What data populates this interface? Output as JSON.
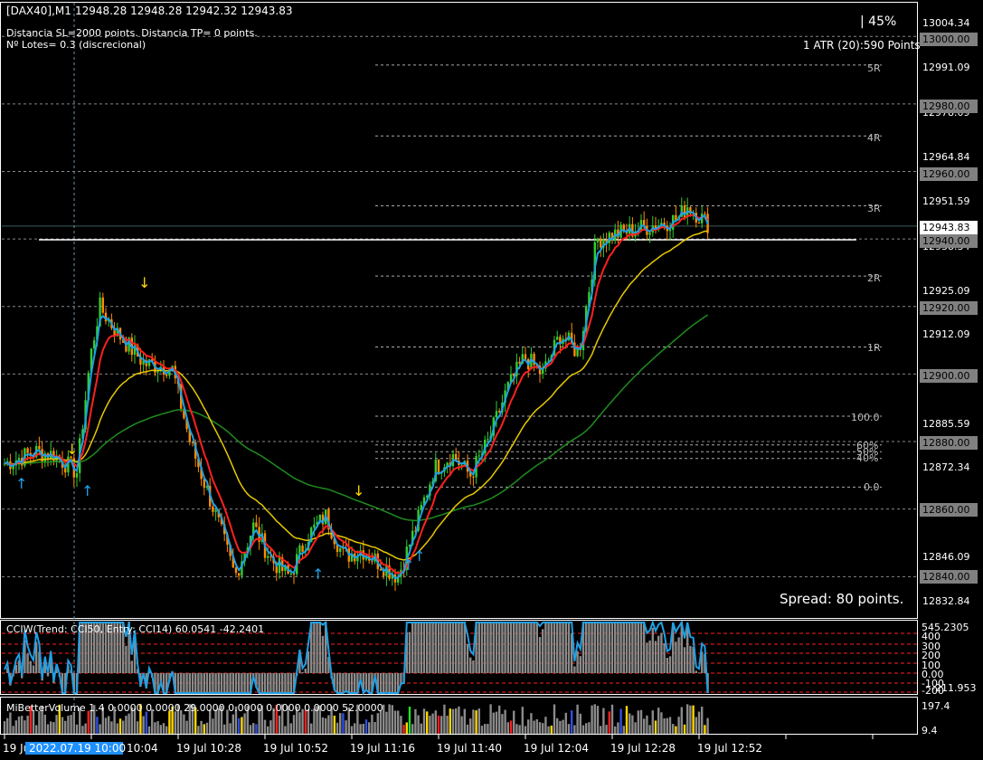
{
  "header": {
    "symbol": "[DAX40],M1",
    "ohlc": "12948.28 12948.28 12942.32 12943.83",
    "sl_tp_info": "Distancia SL=2000 points. Distancia TP= 0 points.",
    "lots_info": "Nº Lotes= 0.3 (discrecional)",
    "percent": "|  45%",
    "atr": "1 ATR (20):590 Points"
  },
  "spread": "Spread: 80 points.",
  "price_axis": {
    "labels": [
      "13004.34",
      "12991.09",
      "12978.09",
      "12964.84",
      "12951.59",
      "12938.34",
      "12925.09",
      "12912.09",
      "12898.84",
      "12885.59",
      "12872.34",
      "12846.09",
      "12832.84"
    ],
    "round_levels": [
      "13000.00",
      "12980.00",
      "12960.00",
      "12940.00",
      "12920.00",
      "12900.00",
      "12880.00",
      "12860.00",
      "12840.00"
    ],
    "current_price": "12943.83"
  },
  "levels": {
    "r_labels": [
      "5R",
      "4R",
      "3R",
      "2R",
      "1R"
    ],
    "fib_labels": [
      "100.0",
      "60%",
      "50%",
      "40%",
      "0.0"
    ]
  },
  "cci": {
    "title": "CCIW(Trend: CCI50, Entry: CCI14) 60.0541 -42.2401",
    "scale": [
      "545.2305",
      "400",
      "300",
      "200",
      "100",
      "0.00",
      "-100",
      "-200",
      "-211.953"
    ]
  },
  "volume": {
    "title": "MiBetterVolume 1.4 0.0000 0.0000 29.0000 0.0000 0.0000 0.0000 52.0000",
    "scale": [
      "197.4",
      "9.4"
    ]
  },
  "time_axis": {
    "cursor_label": "2022.07.19 10:00",
    "labels": [
      "19 Jul",
      "10:04",
      "19 Jul 10:28",
      "19 Jul 10:52",
      "19 Jul 11:16",
      "19 Jul 11:40",
      "19 Jul 12:04",
      "19 Jul 12:28",
      "19 Jul 12:52"
    ]
  },
  "colors": {
    "bull": "#32cd32",
    "bear": "#ff8c00",
    "ma_fast": "#1ea0e6",
    "ma_mid": "#ff2020",
    "ma_slow": "#e6c800",
    "ma_long": "#1e8c1e",
    "cci_line": "#1ea0e6"
  },
  "price_path": [
    [
      0,
      12873
    ],
    [
      20,
      12875
    ],
    [
      40,
      12877
    ],
    [
      60,
      12876
    ],
    [
      85,
      12871
    ],
    [
      100,
      12905
    ],
    [
      110,
      12920
    ],
    [
      130,
      12912
    ],
    [
      160,
      12903
    ],
    [
      190,
      12902
    ],
    [
      210,
      12880
    ],
    [
      240,
      12857
    ],
    [
      260,
      12840
    ],
    [
      280,
      12855
    ],
    [
      300,
      12845
    ],
    [
      320,
      12840
    ],
    [
      340,
      12852
    ],
    [
      360,
      12858
    ],
    [
      380,
      12846
    ],
    [
      400,
      12848
    ],
    [
      440,
      12840
    ],
    [
      460,
      12855
    ],
    [
      480,
      12872
    ],
    [
      500,
      12876
    ],
    [
      520,
      12870
    ],
    [
      540,
      12880
    ],
    [
      560,
      12895
    ],
    [
      580,
      12905
    ],
    [
      600,
      12900
    ],
    [
      620,
      12912
    ],
    [
      640,
      12906
    ],
    [
      660,
      12940
    ],
    [
      690,
      12942
    ],
    [
      720,
      12944
    ],
    [
      750,
      12946
    ],
    [
      760,
      12950
    ],
    [
      785,
      12944
    ]
  ]
}
